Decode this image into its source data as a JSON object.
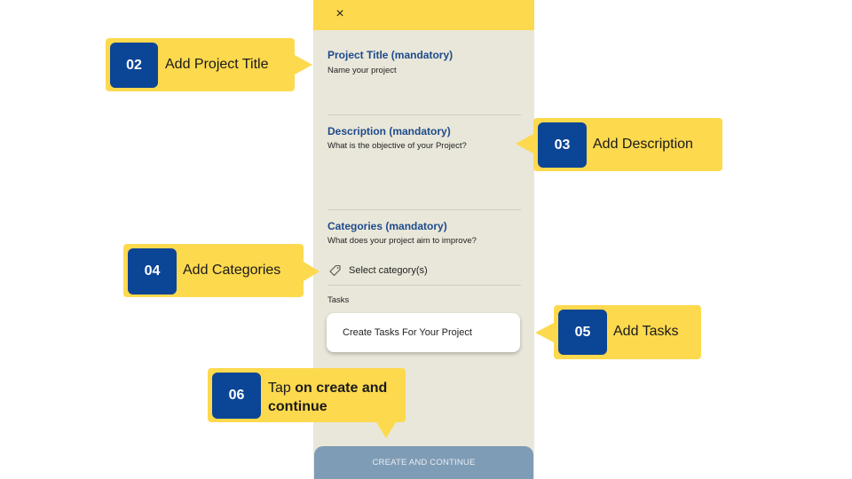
{
  "phone": {
    "close_glyph": "×",
    "project_title_heading": "Project Title (mandatory)",
    "project_title_placeholder": "Name your project",
    "description_heading": "Description (mandatory)",
    "description_placeholder": "What is the objective of your Project?",
    "categories_heading": "Categories (mandatory)",
    "categories_hint": "What does your project aim to improve?",
    "select_category_label": "Select category(s)",
    "tasks_label": "Tasks",
    "tasks_button_label": "Create Tasks For Your Project",
    "create_button_label": "CREATE AND CONTINUE"
  },
  "callouts": [
    {
      "number": "02",
      "text": "Add Project Title"
    },
    {
      "number": "03",
      "text": "Add Description"
    },
    {
      "number": "04",
      "text": "Add Categories"
    },
    {
      "number": "05",
      "text": "Add Tasks"
    },
    {
      "number": "06",
      "text_prefix": "Tap ",
      "text_bold": "on create and continue"
    }
  ],
  "colors": {
    "accent_yellow": "#fdd94e",
    "badge_blue": "#0b4596",
    "heading_blue": "#1e4a8c",
    "phone_bg": "#e9e7d9",
    "button_disabled": "#7f9cb6"
  },
  "icons": {
    "close": "close-icon",
    "tag": "tag-icon"
  }
}
